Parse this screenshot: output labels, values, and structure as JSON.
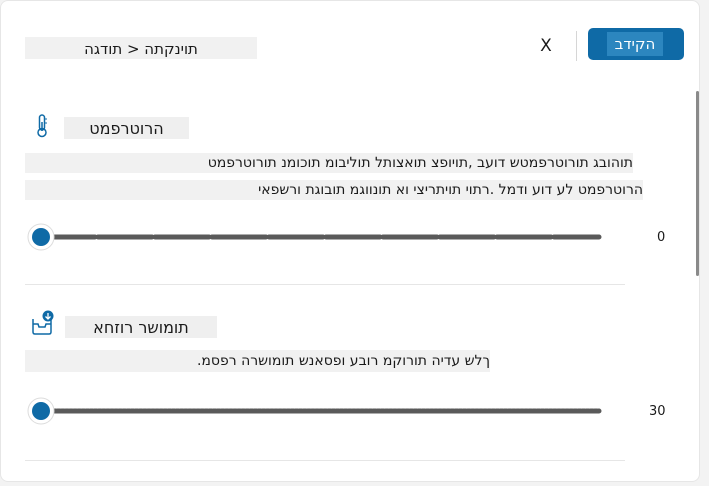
{
  "header": {
    "breadcrumb": "תוינקתה < תודגה",
    "close_label": "X",
    "submit_label": "הקידב"
  },
  "sections": [
    {
      "title": "הרוטרפמט",
      "desc_line1": "תוהובג תורוטרפמטש דועב ,תויופצ תואצותל תוליבומ תוכומנ תורוטרפמט",
      "desc_line2": "הרוטרפמט לע דוע ודמל .רתוי תויתריצי וא תונווגמ תובוגת ורשפאי",
      "value": "0",
      "level": 0
    },
    {
      "title": "תומושר רוזחא",
      "desc": "ךלש עדיה תורוקמ רובע ופסאנש תומושרה רפסמ.",
      "value": "30",
      "level": 0
    }
  ],
  "colors": {
    "accent": "#0f6aa6",
    "slider_thumb": "#0f6aa6",
    "track": "#5a5a5a"
  }
}
